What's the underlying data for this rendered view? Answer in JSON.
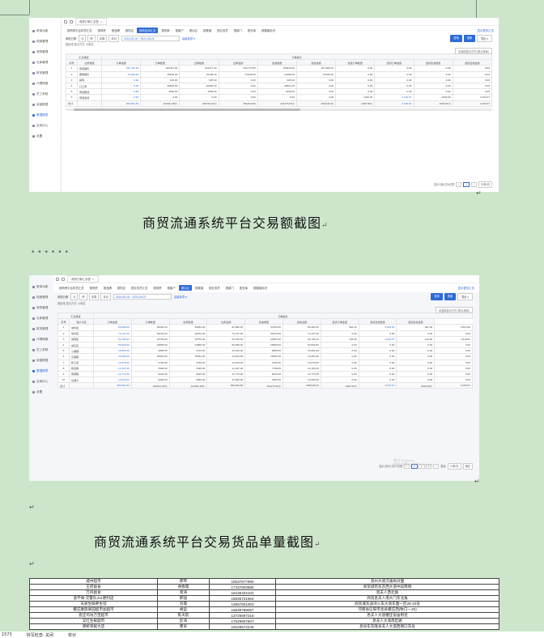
{
  "sidebar": {
    "items": [
      {
        "label": "常用功能",
        "active": false
      },
      {
        "label": "档案管理",
        "active": false
      },
      {
        "label": "采购管理",
        "active": false
      },
      {
        "label": "仓库管理",
        "active": false
      },
      {
        "label": "财务管理",
        "active": false
      },
      {
        "label": "代理商管",
        "active": false
      },
      {
        "label": "员工考核",
        "active": false
      },
      {
        "label": "经营数据",
        "active": false
      },
      {
        "label": "数据报表",
        "active": true
      },
      {
        "label": "应用中心",
        "active": false
      },
      {
        "label": "设置",
        "active": false
      }
    ]
  },
  "shot1": {
    "window_tab": "商贸订单汇总表",
    "subtabs": [
      "按商贸平台供货汇总",
      "按商贸",
      "按品牌",
      "按供应",
      "按供应商汇总",
      "按商家",
      "按客户",
      "按片区",
      "按渠道",
      "按业务员",
      "按部门",
      "按仓库",
      "按模板标识"
    ],
    "active_subtab": 4,
    "right_link": "显示更多汇总",
    "filter": {
      "date_label": "单据日期",
      "chips": [
        "今",
        "昨",
        "本周",
        "本月"
      ],
      "date_range": "2024-08-16  ~  2024-08-22",
      "more": "高级选项 ▾"
    },
    "buttons": {
      "query": "查询",
      "reset": "重置",
      "export": "导出 ▾"
    },
    "crumb": "按区域 显示方式: 小单位",
    "selector": "请选择显示方式 (默认排序)",
    "group_header_left": "汇总维度",
    "group_header_right": "订单报价",
    "columns": [
      "序号",
      "业务维度",
      "订单金额",
      "订单数量",
      "出库数量",
      "出库金额",
      "签收数量",
      "签收金额",
      "退货订单数量",
      "退货订单金额",
      "退货签收数量",
      "退货签收金额"
    ],
    "rows": [
      [
        "1",
        "商贸销售",
        "381,110.00",
        "163457.00",
        "163477.00",
        "330,770.85",
        "163934.00",
        "257,805.22",
        "0.00",
        "0.00",
        "0.00",
        "0.00"
      ],
      [
        "2",
        "团购销售",
        "70,840.00",
        "15180.00",
        "15180.00",
        "70,840.00",
        "15180.00",
        "70,840.00",
        "0.00",
        "0.00",
        "0.00",
        "0.00"
      ],
      [
        "3",
        "其他",
        "0.00",
        "925.00",
        "925.00",
        "0.00",
        "925.00",
        "0.00",
        "0.00",
        "0.00",
        "0.00",
        "0.00"
      ],
      [
        "4",
        "订口商",
        "0.00",
        "40500.00",
        "40500.00",
        "0.00",
        "40521.00",
        "0.00",
        "0.00",
        "0.00",
        "0.00",
        "0.00"
      ],
      [
        "5",
        "商贸赠送",
        "0.00",
        "1590.00",
        "1590.00",
        "0.00",
        "1590.00",
        "0.00",
        "0.00",
        "0.00",
        "0.00",
        "0.00"
      ],
      [
        "6",
        "商贸退货",
        "0.00",
        "0.00",
        "0.00",
        "0.00",
        "0.00",
        "0.00",
        "1020.00",
        "3,152.67",
        "1020.00",
        "3,152.67"
      ]
    ],
    "sum_row": [
      "合计",
      "",
      "450,951.54",
      "222041.00小",
      "222491.00小",
      "450,610.82",
      "221476.00小",
      "409,646.22",
      "1020.00小",
      "3,152.67",
      "1020.00小",
      "3,152.67"
    ],
    "pager": {
      "total": "显示1到6,共6记录",
      "page": "1",
      "size": "50条/页"
    }
  },
  "caption1": "商贸流通系统平台交易额截图",
  "dots": "••••••",
  "shot2": {
    "window_tab": "商贸订单汇总表",
    "subtabs": [
      "按商贸平台供货汇总",
      "按商贸",
      "按品牌",
      "按供应",
      "按业务员汇总",
      "按商贸",
      "按客户",
      "按片区",
      "按渠道",
      "按业务员",
      "按部门",
      "按仓库",
      "按模板标识"
    ],
    "active_subtab": 7,
    "right_link": "显示更多汇总",
    "filter": {
      "date_label": "单据日期",
      "chips": [
        "今",
        "昨",
        "本周",
        "本月"
      ],
      "date_range": "2024-08-16  ~  2024-08-22",
      "more": "高级选项 ▾"
    },
    "buttons": {
      "query": "查询",
      "reset": "重置",
      "export": "导出 ▾"
    },
    "crumb": "按区域 显示方式: 小单位",
    "selector": "请选择显示方式 (默认排序)",
    "group_header_left": "汇总维度",
    "group_header_right": "订单报价",
    "columns": [
      "序号",
      "客户片区",
      "订单金额",
      "订单数量",
      "出库数量",
      "出库金额",
      "签收数量",
      "签收金额",
      "退货订单金额",
      "退货签收数量",
      "退货签收金额"
    ],
    "rows": [
      [
        "1",
        "城中区",
        "83,888.00",
        "45664.00",
        "45664.00",
        "83,890.25",
        "37053.00",
        "83,480.23",
        "901.00",
        "3,524.00",
        "901.00",
        "3,524.00"
      ],
      [
        "2",
        "城北区",
        "72,137.00",
        "32234.00",
        "32234.00",
        "72,137.00",
        "32234.00",
        "72,137.00",
        "0.00",
        "0.00",
        "0.00",
        "0.00"
      ],
      [
        "3",
        "城西区",
        "54,796.62",
        "23752.00",
        "23752.00",
        "54,795.62",
        "23687.00",
        "54,795.22",
        "134.00",
        "1,618.67",
        "134.00",
        "1,618.67"
      ],
      [
        "4",
        "城东区",
        "50,828.00",
        "24865.00",
        "24865.00",
        "50,828.00",
        "24865.00",
        "50,828.00",
        "0.00",
        "0.00",
        "0.00",
        "0.00"
      ],
      [
        "5",
        "小镇镇",
        "15,852.00",
        "4865.00",
        "4743.00",
        "15,242.00",
        "4865.00",
        "16,092.00",
        "0.00",
        "0.00",
        "0.00",
        "0.00"
      ],
      [
        "6",
        "东昌镇",
        "14,659.00",
        "16661.00",
        "16661.00",
        "14,634.00",
        "16661.00",
        "14,659.00",
        "0.00",
        "0.00",
        "0.00",
        "0.00"
      ],
      [
        "7",
        "新乙县",
        "14,079.00",
        "2782.00",
        "2782.00",
        "14,079.00",
        "2782.00",
        "14,079.00",
        "0.00",
        "0.00",
        "0.00",
        "0.00"
      ],
      [
        "8",
        "新店镇",
        "12,307.00",
        "7828.00",
        "7828.00",
        "12,307.00",
        "7798.00",
        "12,150.00",
        "0.00",
        "0.00",
        "0.00",
        "0.00"
      ],
      [
        "9",
        "南港镇",
        "12,770.00",
        "6640.00",
        "6640.00",
        "12,770.00",
        "6640.00",
        "12,770.00",
        "0.00",
        "0.00",
        "0.00",
        "0.00"
      ],
      [
        "10",
        "长顺乡",
        "12,000.00",
        "2082.00",
        "2082.00",
        "12,000.00",
        "2082.00",
        "12,000.00",
        "0.00",
        "0.00",
        "0.00",
        "0.00"
      ]
    ],
    "sum_row": [
      "合计",
      "",
      "450,951.54",
      "222041.00小",
      "222491.00小",
      "450,610.82",
      "221476.00小",
      "409,646.22",
      "1020.00小",
      "3,152.67",
      "1020.00小",
      "3,152.67"
    ],
    "pager": {
      "total": "显示1到10,共27记录",
      "pages": [
        "1",
        "2",
        "3"
      ],
      "goto": "跳至",
      "size": "10条/页",
      "jump": "确定"
    },
    "watermark": [
      "激活 Windows",
      "转到\"设置\"以激活 Windows。"
    ]
  },
  "caption2": "商贸流通系统平台交易货品单量截图",
  "para_mark": "↵",
  "addr_table": {
    "rows": [
      [
        "城中超市",
        "郝琴",
        "15537877990",
        "息州大道交通局对面"
      ],
      [
        "王府副食",
        "谢春霞",
        "17337603895",
        "商贸城市东京西大道中段南侧"
      ],
      [
        "万丹副食",
        "蒋涛",
        "15236402102",
        "息夫人西北角"
      ],
      [
        "道不倚-交警队411便利店",
        "邢强",
        "15836731664",
        "商贸息夫人南大门东北角"
      ],
      [
        "天骄生鲜养生馆",
        "刘霞",
        "13967801003",
        "商贸城东迪湾火车大道东面一区25-10号"
      ],
      [
        "稷庄康旅果园超市加超市",
        "胡垒",
        "15839789087",
        "河南省信阳市息县稷庄西(牧口一20)"
      ],
      [
        "瓷庄坞坊万宝超市",
        "陈天航",
        "13725697218",
        "息夫人大道稷庄宿舍附近"
      ],
      [
        "又红生鲜超市",
        "彭涛",
        "17629907607",
        "息夫人大道南区路"
      ],
      [
        "郑桥荣鲜大店",
        "曹军",
        "15028572246",
        "息县东东隆县夫人大道西侧口东处"
      ]
    ]
  },
  "statusbar": {
    "page": "1573",
    "words": "拼写检查: 关闭",
    "mode": "校对"
  }
}
